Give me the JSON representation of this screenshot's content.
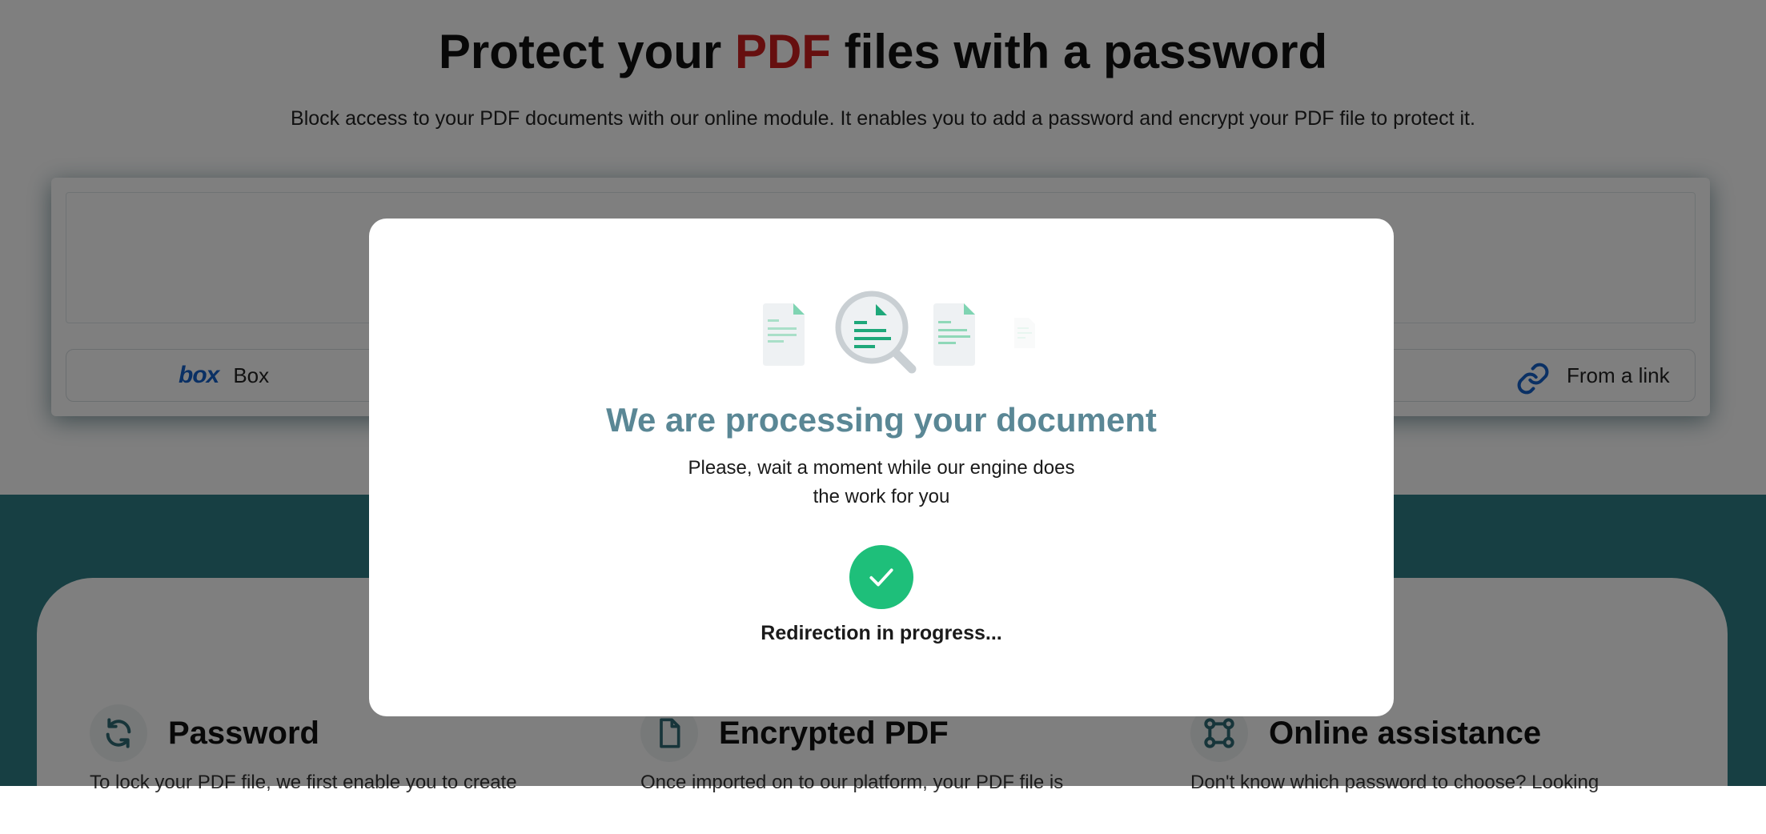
{
  "hero": {
    "title_part1": "Protect your ",
    "title_accent": "PDF",
    "title_part2": " files with a password",
    "subtitle": "Block access to your PDF documents with our online module. It enables you to add a password and encrypt your PDF file to protect it."
  },
  "sources": {
    "box_logo": "box",
    "box_label": "Box",
    "link_label": "From a link"
  },
  "features": [
    {
      "name": "Password",
      "icon": "refresh-icon",
      "text": "To lock your PDF file, we first enable you to create"
    },
    {
      "name": "Encrypted PDF",
      "icon": "file-icon",
      "text": "Once imported on to our platform, your PDF file is"
    },
    {
      "name": "Online assistance",
      "icon": "nodes-icon",
      "text": "Don't know which password to choose? Looking"
    }
  ],
  "modal": {
    "title": "We are processing your document",
    "message": "Please, wait a moment while our engine does the work for you",
    "status": "Redirection in progress..."
  },
  "colors": {
    "accent_red": "#cc1e1e",
    "modal_title": "#5a8795",
    "success_green": "#1ebf7a",
    "teal_bg": "#2e7f86",
    "link_blue": "#1560c9"
  }
}
